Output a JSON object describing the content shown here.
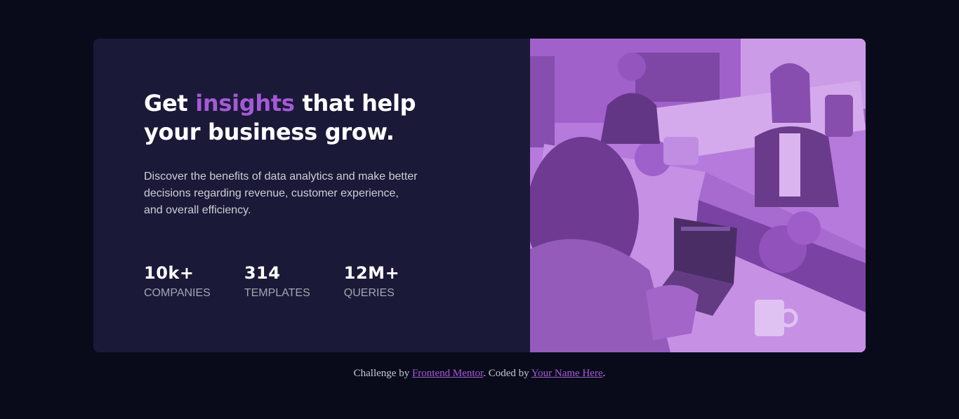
{
  "card": {
    "headline": {
      "before": "Get ",
      "accent": "insights",
      "after": " that help your business grow."
    },
    "description": "Discover the benefits of data analytics and make better decisions regarding revenue, customer experience, and overall efficiency.",
    "stats": [
      {
        "value": "10k+",
        "label": "Companies"
      },
      {
        "value": "314",
        "label": "Templates"
      },
      {
        "value": "12M+",
        "label": "Queries"
      }
    ],
    "image_icon": "office-workers-photo"
  },
  "attribution": {
    "prefix": "Challenge by ",
    "link1": "Frontend Mentor",
    "middle": ". Coded by ",
    "link2": "Your Name Here",
    "suffix": "."
  },
  "colors": {
    "page_bg": "#090b1a",
    "card_bg": "#1b1938",
    "accent": "#a45ad6",
    "image_overlay": "#b57ed8"
  }
}
